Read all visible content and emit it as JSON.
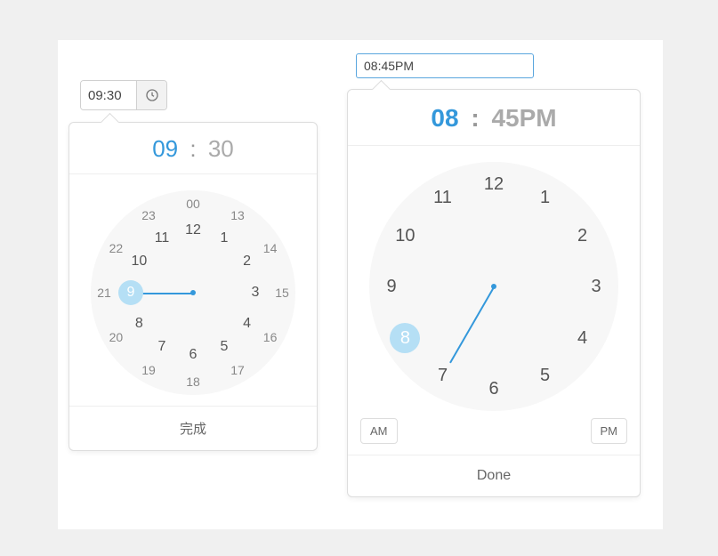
{
  "left_picker": {
    "input_value": "09:30",
    "hours": "09",
    "separator": ":",
    "minutes": "30",
    "selected_hour": 9,
    "inner_hours": [
      "12",
      "1",
      "2",
      "3",
      "4",
      "5",
      "6",
      "7",
      "8",
      "9",
      "10",
      "11"
    ],
    "outer_hours": [
      "00",
      "13",
      "14",
      "15",
      "16",
      "17",
      "18",
      "19",
      "20",
      "21",
      "22",
      "23"
    ],
    "done_label": "完成"
  },
  "right_picker": {
    "input_value": "08:45PM",
    "hours": "08",
    "separator": ":",
    "minutes": "45",
    "period": "PM",
    "selected_hour": 8,
    "hour_labels": [
      "12",
      "1",
      "2",
      "3",
      "4",
      "5",
      "6",
      "7",
      "8",
      "9",
      "10",
      "11"
    ],
    "am_label": "AM",
    "pm_label": "PM",
    "done_label": "Done"
  },
  "colors": {
    "accent": "#3498db",
    "highlight": "#b5dff5"
  }
}
